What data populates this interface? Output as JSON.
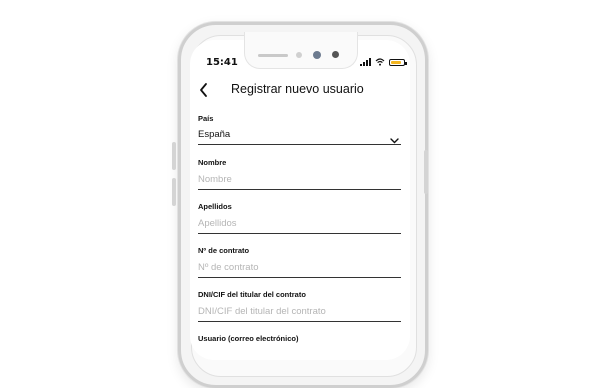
{
  "status_bar": {
    "time": "15:41"
  },
  "header": {
    "title": "Registrar nuevo usuario"
  },
  "form": {
    "pais": {
      "label": "País",
      "value": "España"
    },
    "nombre": {
      "label": "Nombre",
      "placeholder": "Nombre"
    },
    "apellidos": {
      "label": "Apellidos",
      "placeholder": "Apellidos"
    },
    "contrato": {
      "label": "Nº de contrato",
      "placeholder": "Nº de contrato"
    },
    "dni": {
      "label": "DNI/CIF del titular del contrato",
      "placeholder": "DNI/CIF del titular del contrato"
    },
    "usuario": {
      "label": "Usuario (correo electrónico)"
    }
  },
  "colors": {
    "battery": "#f3b51f",
    "text": "#111111",
    "placeholder": "#b5b5b5"
  }
}
